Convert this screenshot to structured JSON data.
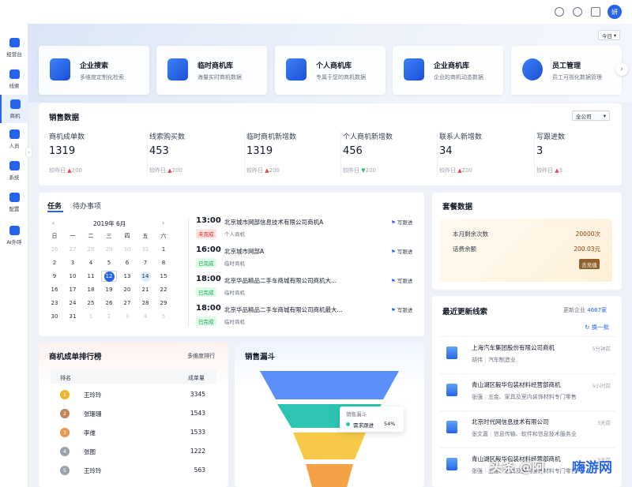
{
  "header": {
    "avatar_text": "妍",
    "icons": [
      "bell-icon",
      "help-icon",
      "message-icon"
    ]
  },
  "sidebar": {
    "items": [
      {
        "label": "经营台",
        "icon": "dashboard-icon"
      },
      {
        "label": "线索",
        "icon": "leads-icon"
      },
      {
        "label": "商机",
        "icon": "opportunity-icon",
        "active": true
      },
      {
        "label": "人员",
        "icon": "people-icon"
      },
      {
        "label": "系统",
        "icon": "system-icon"
      },
      {
        "label": "配置",
        "icon": "config-icon"
      },
      {
        "label": "AI外呼",
        "icon": "ai-call-icon"
      }
    ]
  },
  "banner": {
    "period": "今日",
    "cards": [
      {
        "title": "企业搜索",
        "subtitle": "多维度定制化检索",
        "icon": "search-company-icon"
      },
      {
        "title": "临时商机库",
        "subtitle": "海量实时商机数据",
        "icon": "folder-icon"
      },
      {
        "title": "个人商机库",
        "subtitle": "专属于您的商机数据",
        "icon": "personal-folder-icon"
      },
      {
        "title": "企业商机库",
        "subtitle": "企业的商机动态数据",
        "icon": "document-icon"
      },
      {
        "title": "员工管理",
        "subtitle": "员工可视化数据管理",
        "icon": "pie-chart-icon"
      }
    ]
  },
  "sales": {
    "title": "销售数据",
    "scope": "全公司",
    "metrics": [
      {
        "label": "商机成单数",
        "value": "1319",
        "cmp_label": "较昨日",
        "cmp_value": "200",
        "trend": "up"
      },
      {
        "label": "线索购买数",
        "value": "453",
        "cmp_label": "较昨日",
        "cmp_value": "200",
        "trend": "up"
      },
      {
        "label": "临时商机新增数",
        "value": "1319",
        "cmp_label": "较昨日",
        "cmp_value": "200",
        "trend": "up"
      },
      {
        "label": "个人商机新增数",
        "value": "456",
        "cmp_label": "较昨日",
        "cmp_value": "200",
        "trend": "down"
      },
      {
        "label": "联系人新增数",
        "value": "34",
        "cmp_label": "较昨日",
        "cmp_value": "200",
        "trend": "up"
      },
      {
        "label": "写跟进数",
        "value": "3",
        "cmp_label": "较昨日",
        "cmp_value": "3",
        "trend": "up"
      }
    ]
  },
  "tasks": {
    "tabs": [
      "任务",
      "待办事项"
    ],
    "calendar": {
      "month_label": "2019年 6月",
      "weekdays": [
        "日",
        "一",
        "二",
        "三",
        "四",
        "五",
        "六"
      ],
      "weeks": [
        [
          "26",
          "27",
          "28",
          "29",
          "30",
          "31",
          "1"
        ],
        [
          "2",
          "3",
          "4",
          "5",
          "6",
          "7",
          "8"
        ],
        [
          "9",
          "10",
          "11",
          "12",
          "13",
          "14",
          "15"
        ],
        [
          "16",
          "17",
          "18",
          "19",
          "20",
          "21",
          "22"
        ],
        [
          "23",
          "24",
          "25",
          "26",
          "27",
          "28",
          "29"
        ],
        [
          "30",
          "31",
          "1",
          "2",
          "3",
          "4",
          "5"
        ]
      ],
      "today": "12",
      "selected": "14"
    },
    "items": [
      {
        "time": "13:00",
        "status": "未完成",
        "status_type": "red",
        "title": "北京城市网部信息技术有限公司商机A",
        "sub": "个人商机",
        "action": "写跟进"
      },
      {
        "time": "16:00",
        "status": "已完成",
        "status_type": "green",
        "title": "北京城市网部A",
        "sub": "临时商机",
        "action": "写跟进"
      },
      {
        "time": "18:00",
        "status": "已完成",
        "status_type": "green",
        "title": "北京华品精品二手车商城有限公司商机大...",
        "sub": "临时商机",
        "action": "写跟进"
      },
      {
        "time": "18:00",
        "status": "已完成",
        "status_type": "green",
        "title": "北京华品精品二手车商城有限公司商机最大...",
        "sub": "临时商机",
        "action": "写跟进"
      }
    ]
  },
  "package": {
    "title": "套餐数据",
    "rows": [
      {
        "label": "本月剩余次数",
        "value": "20000次"
      },
      {
        "label": "话费余额",
        "value": "200.03元"
      }
    ],
    "recharge": "去充值"
  },
  "leads": {
    "title": "最近更新线索",
    "update_prefix": "更新企业",
    "update_count": "4667家",
    "refresh": "换一批",
    "items": [
      {
        "name": "上海汽车集团股份有限公司商机",
        "person": "胡伟",
        "industry": "汽车制造业",
        "time": "5分钟前"
      },
      {
        "name": "青山湖区毅华包装材料经营部商机",
        "person": "张强",
        "industry": "五金、家具及室内装饰材料专门零售",
        "time": "5小时前"
      },
      {
        "name": "北京时代网信息技术有限公司",
        "person": "张文嘉",
        "industry": "信息传输、软件和信息技术服务业",
        "time": "3天前"
      },
      {
        "name": "青山湖区毅华包装材料经营部商机",
        "person": "张强",
        "industry": "五金、家具及室内装饰材料专门零售",
        "time": "3天前"
      }
    ]
  },
  "ranking": {
    "title": "商机成单排行榜",
    "filter": "多维度排行",
    "col_rank": "排名",
    "col_count": "成单量",
    "rows": [
      {
        "rank": "1",
        "name": "王玲玲",
        "count": "3345",
        "medal": "gold"
      },
      {
        "rank": "2",
        "name": "张珊珊",
        "count": "1543",
        "medal": "silver"
      },
      {
        "rank": "3",
        "name": "李维",
        "count": "1533",
        "medal": "bronze"
      },
      {
        "rank": "4",
        "name": "张图",
        "count": "1222",
        "medal": "none"
      },
      {
        "rank": "5",
        "name": "王玲玲",
        "count": "563",
        "medal": "none"
      }
    ]
  },
  "funnel": {
    "title": "销售漏斗",
    "tooltip_title": "销售漏斗",
    "tooltip_label": "需求跟进",
    "tooltip_value": "54%",
    "stage_colors": [
      "#5b8ff9",
      "#2dc4b2",
      "#f6c948",
      "#f5a146",
      "#f2725b"
    ]
  },
  "watermark": {
    "text1": "头条 @阿",
    "text2": "嗨游网"
  }
}
